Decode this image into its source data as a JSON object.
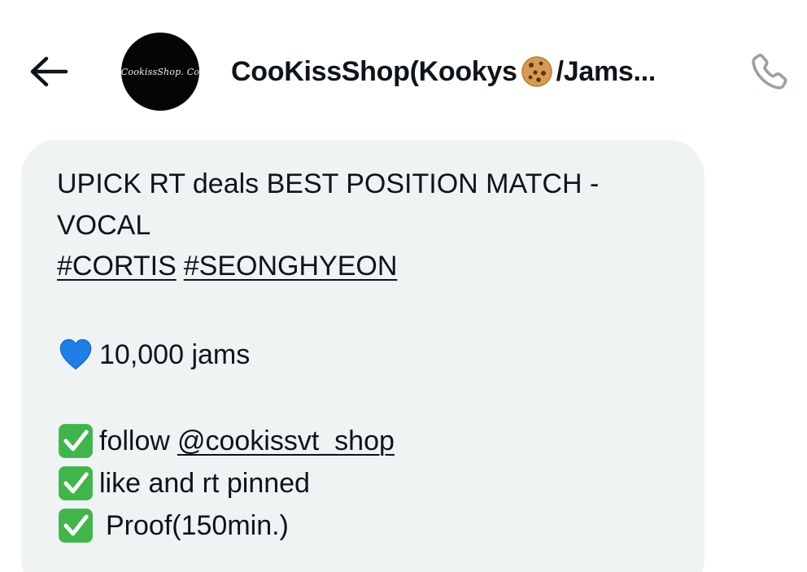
{
  "header": {
    "contact_name_part1": "CooKissShop(Kookys",
    "contact_name_part2": "/Jams...",
    "avatar_text": "CookissShop. Co",
    "icons": {
      "back": "arrow-left-icon",
      "name_emoji": "cookie-icon",
      "call": "phone-icon"
    }
  },
  "message": {
    "line1": "UPICK RT deals BEST POSITION MATCH -",
    "line2": "VOCAL",
    "hashtags": [
      "#CORTIS",
      "#SEONGHYEON"
    ],
    "prize": "10,000 jams",
    "prize_icon": "blue-heart-icon",
    "task1_prefix": "follow",
    "task1_mention": "@cookissvt_shop",
    "task2": "like and rt pinned",
    "task3": "Proof(150min.)",
    "task_icon": "check-mark-button-icon"
  },
  "colors": {
    "bubble_bg": "#eff3f4",
    "text": "#0f1419",
    "call_icon": "#9a9fa4",
    "check_green": "#3fb54a",
    "heart_blue": "#1f7ee8"
  }
}
